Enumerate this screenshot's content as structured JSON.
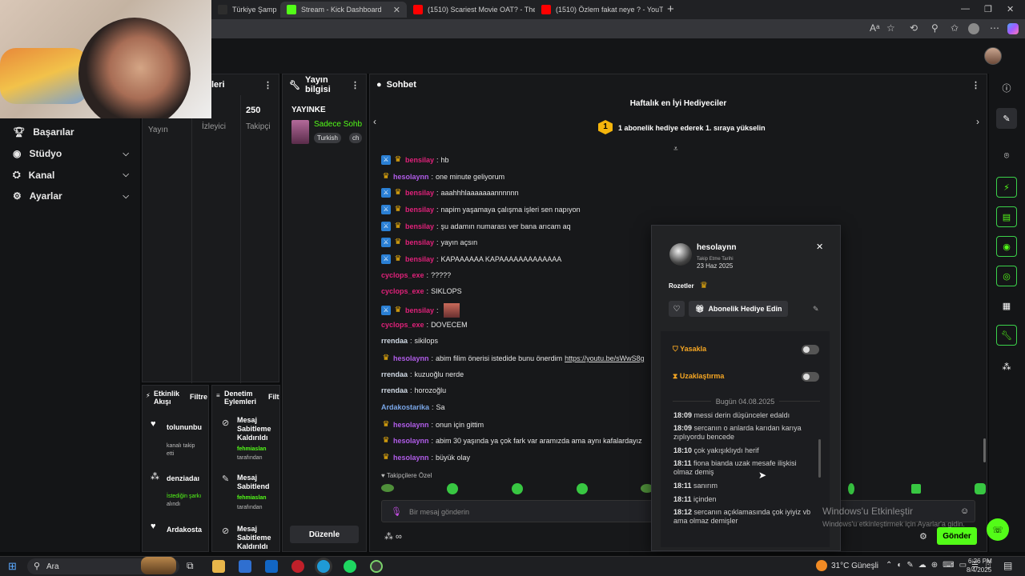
{
  "tabs": [
    {
      "label": "Türkiye Şampiyo",
      "fav": "#2d2d2d"
    },
    {
      "label": "Stream - Kick Dashboard",
      "fav": "#53fc18"
    },
    {
      "label": "(1510) Scariest Movie OAT? - The",
      "fav": "#ff0000"
    },
    {
      "label": "(1510) Özlem fakat neye ? - YouTu",
      "fav": "#ff0000"
    }
  ],
  "nav": [
    {
      "label": "Başarılar",
      "icon": "trophy-icon",
      "chevron": false
    },
    {
      "label": "Stüdyo",
      "icon": "camera-icon",
      "chevron": true
    },
    {
      "label": "Kanal",
      "icon": "channel-icon",
      "chevron": true
    },
    {
      "label": "Ayarlar",
      "icon": "gear-icon",
      "chevron": true
    }
  ],
  "stats_panel": {
    "title_fragment": "leri",
    "value_followers": "250",
    "lbl_stream": "Yayın",
    "lbl_viewers": "İzleyici",
    "lbl_followers": "Takipçi"
  },
  "stream_info": {
    "title": "Yayın bilgisi",
    "live_label": "YAYINKE",
    "stream_title": "Sadece Sohb",
    "tag1": "Turkish",
    "tag2": "ch",
    "edit_button": "Düzenle"
  },
  "activity": {
    "title": "Etkinlik Akışı",
    "filter": "Filtre",
    "items": [
      {
        "user": "tolununbu",
        "desc": "kanalı takip etti"
      },
      {
        "user": "denziadaı",
        "desc_green": "İstediğin şarkı",
        "desc": "alındı"
      },
      {
        "user": "Ardakostа",
        "desc": ""
      }
    ]
  },
  "mod_actions": {
    "title": "Denetim Eylemleri",
    "filter": "Filt",
    "items": [
      {
        "action": "Mesaj Sabitleme Kaldırıldı",
        "by": "fehmiaslan",
        "suffix": "tarafından"
      },
      {
        "action": "Mesaj Sabitlend",
        "by": "fehmiaslan",
        "suffix": "tarafından"
      },
      {
        "action": "Mesaj Sabitleme Kaldırıldı",
        "by": "",
        "suffix": ""
      }
    ]
  },
  "chat": {
    "title": "Sohbet",
    "gifter_title": "Haftalık en İyi Hediyeciler",
    "gifter_rank": "1",
    "gifter_text": "1 abonelik hediye ederek 1. sıraya yükselin",
    "followers_only": "Takipçilere Özel",
    "placeholder": "Bir mesaj gönderin",
    "send": "Gönder",
    "messages": [
      {
        "mod": true,
        "sub": true,
        "user": "bensilay",
        "color": "#e0217a",
        "text": "hb"
      },
      {
        "mod": false,
        "sub": true,
        "user": "hesolaynn",
        "color": "#b05ce8",
        "text": "one minute geliyorum"
      },
      {
        "mod": true,
        "sub": true,
        "user": "bensilay",
        "color": "#e0217a",
        "text": "aaahhhlaaaaaaannnnnn"
      },
      {
        "mod": true,
        "sub": true,
        "user": "bensilay",
        "color": "#e0217a",
        "text": "napim yaşamaya çalışma işleri sen napıyon"
      },
      {
        "mod": true,
        "sub": true,
        "user": "bensilay",
        "color": "#e0217a",
        "text": "şu adamın numarası ver bana arıcam aq"
      },
      {
        "mod": true,
        "sub": true,
        "user": "bensilay",
        "color": "#e0217a",
        "text": "yayın açsın"
      },
      {
        "mod": true,
        "sub": true,
        "user": "bensilay",
        "color": "#e0217a",
        "text": "KAPAAAAAA KAPAAAAAAAAAAAAA"
      },
      {
        "mod": false,
        "sub": false,
        "user": "cyclops_exe",
        "color": "#e0217a",
        "text": "?????"
      },
      {
        "mod": false,
        "sub": false,
        "user": "cyclops_exe",
        "color": "#e0217a",
        "text": "SIKLOPS"
      },
      {
        "mod": true,
        "sub": true,
        "user": "bensilay",
        "color": "#e0217a",
        "text": ""
      },
      {
        "mod": false,
        "sub": false,
        "user": "cyclops_exe",
        "color": "#e0217a",
        "text": "DOVECEM"
      },
      {
        "mod": false,
        "sub": false,
        "user": "rrendaa",
        "color": "#cfd8e3",
        "text": "sikilops"
      },
      {
        "mod": false,
        "sub": true,
        "user": "hesolaynn",
        "color": "#b05ce8",
        "text": "abim filim önerisi istedide bunu önerdim",
        "link": "https://youtu.be/sWwS8g"
      },
      {
        "mod": false,
        "sub": false,
        "user": "rrendaa",
        "color": "#cfd8e3",
        "text": "kuzuoğlu nerde"
      },
      {
        "mod": false,
        "sub": false,
        "user": "rrendaa",
        "color": "#cfd8e3",
        "text": "horozoğlu"
      },
      {
        "mod": false,
        "sub": false,
        "user": "Ardakostarika",
        "color": "#7aa7e8",
        "text": "Sa"
      },
      {
        "mod": false,
        "sub": true,
        "user": "hesolaynn",
        "color": "#b05ce8",
        "text": "onun için gittim"
      },
      {
        "mod": false,
        "sub": true,
        "user": "hesolaynn",
        "color": "#b05ce8",
        "text": "abim 30 yaşında ya çok fark var aramızda ama aynı kafalardayız"
      },
      {
        "mod": false,
        "sub": true,
        "user": "hesolaynn",
        "color": "#b05ce8",
        "text": "büyük olay"
      }
    ]
  },
  "popup": {
    "username": "hesolaynn",
    "follow_label": "Takip Etme Tarihi",
    "follow_date": "23 Haz 2025",
    "badges_label": "Rozetler",
    "gift_button": "Abonelik Hediye Edin",
    "ban_label": "Yasakla",
    "timeout_label": "Uzaklaştırma",
    "date_sep": "Bugün 04.08.2025",
    "log": [
      {
        "time": "18:09",
        "text": "messi derin düşünceler edaldı"
      },
      {
        "time": "18:09",
        "text": "sercanın o anlarda karıdan karıya zıplıyordu bencede"
      },
      {
        "time": "18:10",
        "text": "çok yakışıklıydı herif"
      },
      {
        "time": "18:11",
        "text": "fiona bianda uzak mesafe ilişkisi olmaz demiş"
      },
      {
        "time": "18:11",
        "text": "sanırım"
      },
      {
        "time": "18:11",
        "text": "içinden"
      },
      {
        "time": "18:12",
        "text": "sercanın açıklamasında çok iyiyiz vb ama olmaz demişler"
      }
    ]
  },
  "watermark": {
    "line1": "Windows'u Etkinleştir",
    "line2": "Windows'u etkinleştirmek için Ayarlar'a gidin."
  },
  "taskbar": {
    "search": "Ara",
    "weather": "31°C Güneşli",
    "time": "6:26 PM",
    "date": "8/4/2025"
  }
}
